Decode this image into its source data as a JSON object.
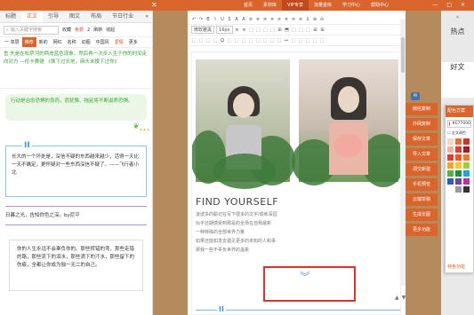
{
  "topbar": {
    "nav": [
      "首页",
      "素材库",
      "VIP专享",
      "流量金库",
      "学习中心",
      "帮助中心"
    ],
    "window_controls": "— □ ✕"
  },
  "left_panel": {
    "tabs": [
      "标题",
      "正文",
      "引导",
      "图文",
      "布局",
      "节日行业"
    ],
    "tabs_arrow": "»",
    "search_placeholder": "输入关键字搜索",
    "search_links": [
      "收藏",
      "免费",
      "2",
      "刷新",
      "收起"
    ],
    "subtabs": [
      "一 单层",
      "推荐",
      "新的",
      "网红",
      "名称",
      "动图",
      "中国风",
      "爱情",
      "更多"
    ],
    "block1_text": "鱼 先是在松萨河的两岸蓝色现象。然后再一次步入生于你的时间走向对方 —伦卡赛德 《换下过天地，麻头未换下过你》",
    "bubble_text": "行动是治愈恐惧的良药，而犹豫、拖延将不断滋养恐惧。",
    "quote_mark": "II",
    "quote_text": "长大的一个坏处是，深信不疑的东西越来越少，活得一天比一天不确定，更怀疑对一些东西深信不疑了。——飞行者小北",
    "lined_text": "日暮之光，告知你色之深。by尼平",
    "ring_text": "你的人生永远不会辜负你的。那些转错的弯，那些走错的路，那些流下的泪水，那些滴下的汗水，那些留下的伤痕，全都让你成为独一无二的自己。"
  },
  "editor": {
    "toolbar1": [
      "↶",
      "↷",
      "B",
      "I",
      "U",
      "S",
      "A",
      "A",
      "≡",
      "≡",
      "≡",
      "≡",
      "≡",
      "≡",
      "≡",
      "≡",
      "ℹ",
      "⊕",
      "⊖"
    ],
    "toolbar2": [
      "微软雅黑",
      "16px",
      "≡",
      "≡",
      "⬚",
      "⬚",
      "⬚",
      "⬚",
      "⊞",
      "⬒",
      "⬚",
      "⬚",
      "⬚",
      "⊞",
      "⊞"
    ],
    "toolbar3": [
      "⬚",
      "⬚",
      "⬚",
      "⬚",
      "Ω",
      "⬚",
      "⬚",
      "⬚",
      "⬚",
      "⬚",
      "⬚",
      "⬚",
      "⬚",
      "↔",
      "⬚",
      "⬚",
      "⬚",
      "⬚",
      "⬚"
    ],
    "headline": "FIND YOURSELF",
    "poem": [
      "凌波多的聪记在写下很多的文字/成练深园",
      "似乎还期感受到那是的全场在自我最新",
      "一种特殊的全部世界力量",
      "如果还能如发去遇见更多的未知的人和事",
      "那我一些不辜负世界的温柔"
    ],
    "chevron": "︾",
    "bottom_mark": "II"
  },
  "action_buttons": [
    "微信复制",
    "外网复制",
    "保存文章",
    "导入文章",
    "调交新建",
    "手机预览",
    "云端草稿",
    "生成长图",
    "更多功能"
  ],
  "bubble_icon": "✉",
  "vertical_tabs": {
    "collapse": "«",
    "items": [
      "热点",
      "好文"
    ]
  },
  "color_picker": {
    "title": "配色方案",
    "hex_value": "#E77000",
    "option_label": "全文调色",
    "footer": "特色功能",
    "swatches": [
      "#f7d6c2",
      "#e86b3a",
      "#c43a2a",
      "#f1b2a4",
      "#d4413a",
      "#a01e24",
      "#e23c2c",
      "#f0591a",
      "#e87a28",
      "#f6a32c",
      "#f7c930",
      "#9fcf3a",
      "#56b04a",
      "#1d8f47",
      "#26a3d6",
      "#2f5fb4",
      "#6b43a3",
      "#b2369a",
      "#ffffff",
      "#999999",
      "#333333"
    ]
  }
}
